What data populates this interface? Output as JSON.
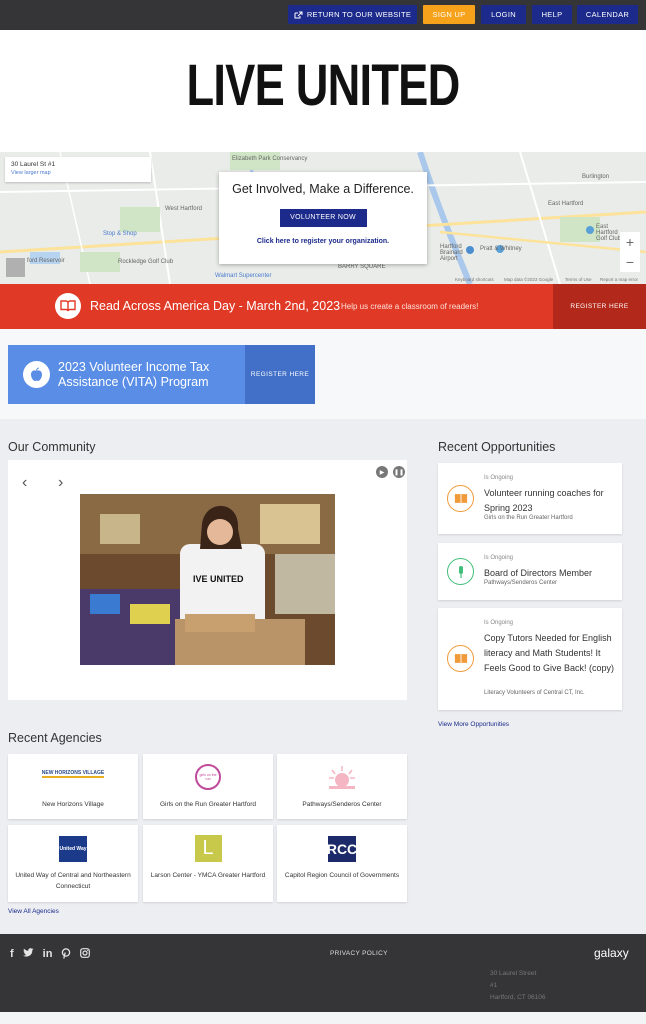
{
  "topbar": {
    "return_label": "RETURN TO OUR WEBSITE",
    "signup_label": "SIGN UP",
    "login_label": "LOGIN",
    "help_label": "HELP",
    "calendar_label": "CALENDAR"
  },
  "header": {
    "logo_text": "LIVE UNITED"
  },
  "map": {
    "address": "30 Laurel St #1",
    "view_larger": "View larger map",
    "card_title": "Get Involved, Make a Difference.",
    "volunteer_label": "VOLUNTEER NOW",
    "register_org_label": "Click here to register your organization.",
    "place_labels": [
      "Elizabeth Park Conservancy",
      "West Hartford",
      "Stop & Shop",
      "East Hartford",
      "Burlington",
      "Pratt & Whitney",
      "Walmart Supercenter",
      "BARRY SQUARE",
      "Rockledge Golf Club",
      "Hartford Brainard Airport",
      "East Hartford Golf Club",
      "ford Reservoir"
    ],
    "footer_texts": [
      "Keyboard shortcuts",
      "Map data ©2023 Google",
      "Terms of Use",
      "Report a map error"
    ],
    "zoom_in": "+",
    "zoom_out": "−"
  },
  "banner": {
    "title": "Read Across America Day - March 2nd, 2023",
    "subtitle": "Help us create a classroom of readers!",
    "register_label": "REGISTER HERE",
    "icon": "book-icon"
  },
  "vita": {
    "title": "2023 Volunteer Income Tax Assistance (VITA) Program",
    "register_label": "REGISTER HERE",
    "icon": "apple-icon"
  },
  "community": {
    "heading": "Our Community",
    "prev": "‹",
    "next": "›",
    "shirt_text": "IVE UNITED"
  },
  "opportunities": {
    "heading": "Recent Opportunities",
    "items": [
      {
        "tag": "Is Ongoing",
        "title": "Volunteer running coaches for Spring 2023",
        "org": "Girls on the Run Greater Hartford",
        "icon": "book-icon"
      },
      {
        "tag": "Is Ongoing",
        "title": "Board of Directors Member",
        "org": "Pathways/Senderos Center",
        "icon": "microphone-icon"
      },
      {
        "tag": "Is Ongoing",
        "title": "Copy Tutors Needed for English literacy and Math Students! It Feels Good to Give Back! (copy)",
        "org": "Literacy Volunteers of Central CT, Inc.",
        "icon": "book-icon"
      }
    ],
    "view_more": "View More Opportunities"
  },
  "agencies": {
    "heading": "Recent Agencies",
    "items": [
      {
        "name": "New Horizons Village",
        "logo_text": "NEW HORIZONS VILLAGE"
      },
      {
        "name": "Girls on the Run Greater Hartford",
        "logo_text": "girls on the run"
      },
      {
        "name": "Pathways/Senderos Center",
        "logo_text": ""
      },
      {
        "name": "United Way of Central and Northeastern Connecticut",
        "logo_text": "United Way"
      },
      {
        "name": "Larson Center - YMCA Greater Hartford",
        "logo_text": "L"
      },
      {
        "name": "Capitol Region Council of Governments",
        "logo_text": "RCC"
      }
    ],
    "view_all": "View All Agencies"
  },
  "footer": {
    "social": [
      "f",
      "t",
      "in",
      "p",
      "ig"
    ],
    "privacy": "PRIVACY POLICY",
    "brand": "galaxy",
    "address_lines": [
      "30 Laurel Street",
      "#1",
      "Hartford, CT 06106"
    ]
  },
  "colors": {
    "navy": "#1c2a8c",
    "orange": "#f6a21a",
    "red": "#e03a26",
    "blue": "#5a8ee6",
    "dark": "#353538"
  }
}
